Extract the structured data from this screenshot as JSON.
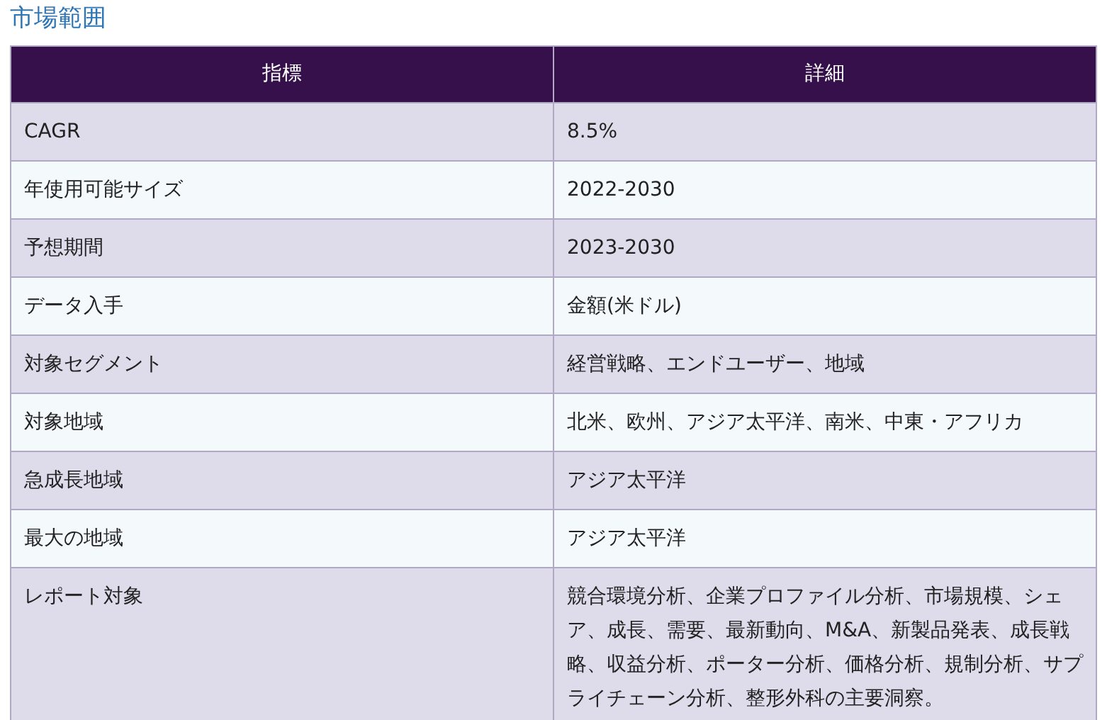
{
  "title": "市場範囲",
  "table": {
    "columns": [
      "指標",
      "詳細"
    ],
    "rows": [
      [
        "CAGR",
        "8.5%"
      ],
      [
        "年使用可能サイズ",
        "2022-2030"
      ],
      [
        "予想期間",
        "2023-2030"
      ],
      [
        "データ入手",
        "金額(米ドル)"
      ],
      [
        "対象セグメント",
        "経営戦略、エンドユーザー、地域"
      ],
      [
        "対象地域",
        "北米、欧州、アジア太平洋、南米、中東・アフリカ"
      ],
      [
        "急成長地域",
        "アジア太平洋"
      ],
      [
        "最大の地域",
        "アジア太平洋"
      ],
      [
        "レポート対象",
        "競合環境分析、企業プロファイル分析、市場規模、シェア、成長、需要、最新動向、M&A、新製品発表、成長戦略、収益分析、ポーター分析、価格分析、規制分析、サプライチェーン分析、整形外科の主要洞察。"
      ]
    ]
  }
}
